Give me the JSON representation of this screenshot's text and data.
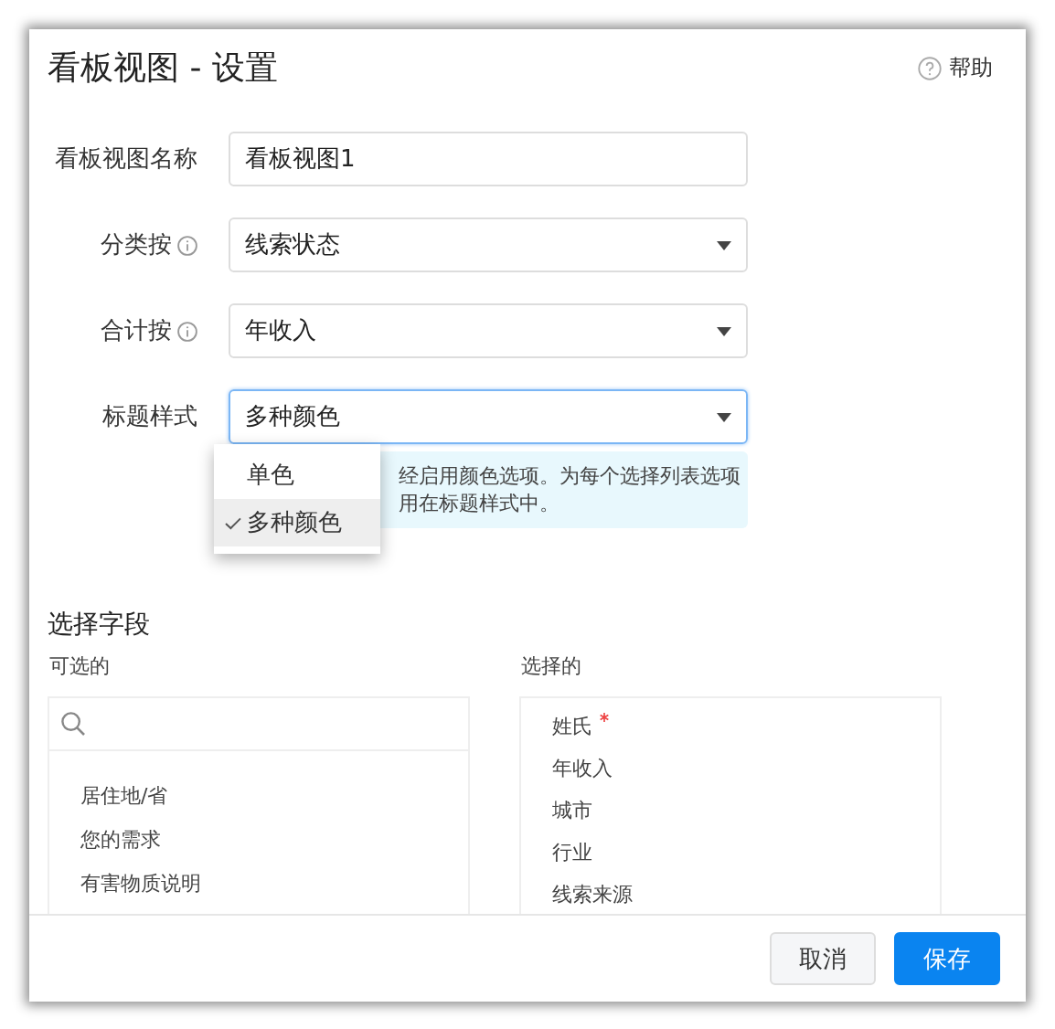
{
  "window": {
    "title": "看板视图 - 设置",
    "help": "帮助"
  },
  "form": [
    {
      "kind": "text",
      "label": "看板视图名称",
      "info": false,
      "value": "看板视图1",
      "focused": false
    },
    {
      "kind": "select",
      "label": "分类按",
      "info": true,
      "value": "线索状态",
      "focused": false
    },
    {
      "kind": "select",
      "label": "合计按",
      "info": true,
      "value": "年收入",
      "focused": false
    },
    {
      "kind": "select",
      "label": "标题样式",
      "info": false,
      "value": "多种颜色",
      "focused": true
    }
  ],
  "info_box": {
    "lines": [
      "经启用颜色选项。为每个选择列表选项",
      "用在标题样式中。"
    ]
  },
  "dropdown": {
    "options": [
      {
        "label": "单色",
        "selected": false
      },
      {
        "label": "多种颜色",
        "selected": true
      }
    ]
  },
  "fields": {
    "title": "选择字段",
    "available": {
      "label": "可选的",
      "items": [
        "居住地/省",
        "您的需求",
        "有害物质说明"
      ]
    },
    "selected": {
      "label": "选择的",
      "items": [
        {
          "label": "姓氏",
          "required": true
        },
        {
          "label": "年收入",
          "required": false
        },
        {
          "label": "城市",
          "required": false
        },
        {
          "label": "行业",
          "required": false
        },
        {
          "label": "线索来源",
          "required": false
        }
      ]
    }
  },
  "buttons": [
    {
      "label": "取消",
      "kind": "secondary"
    },
    {
      "label": "保存",
      "kind": "primary"
    }
  ]
}
